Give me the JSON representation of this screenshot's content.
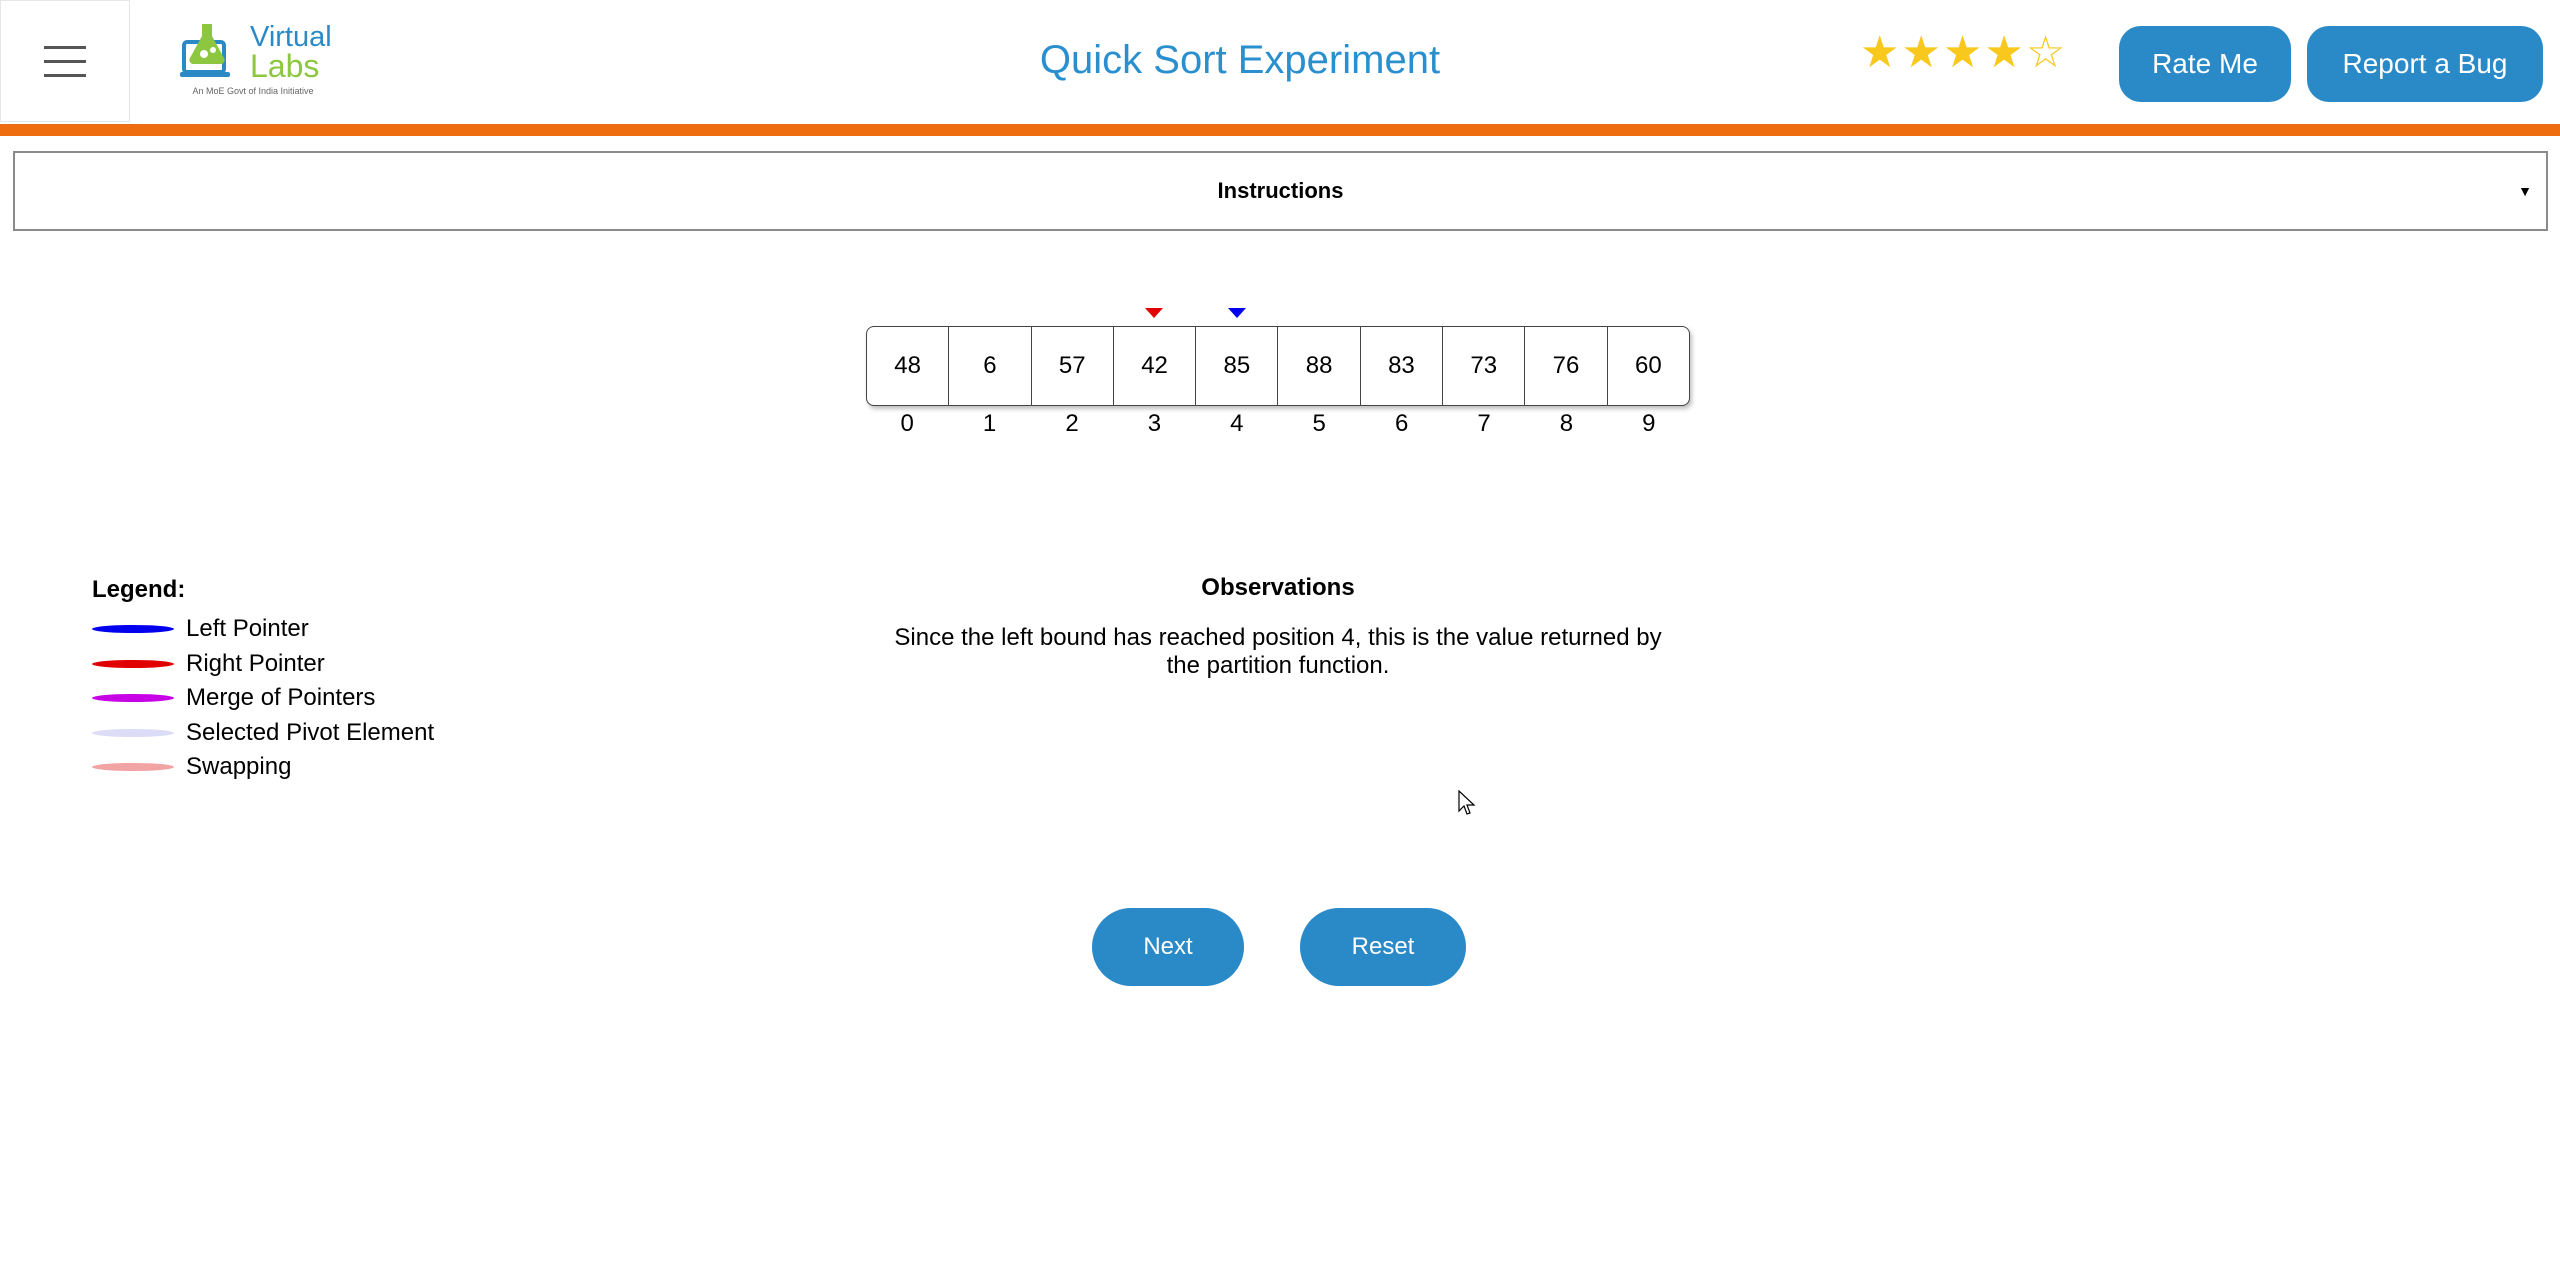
{
  "header": {
    "logo": {
      "title": "Virtual",
      "subtitle": "Labs",
      "tagline": "An MoE Govt of India Initiative"
    },
    "title": "Quick Sort Experiment",
    "rating": {
      "value": 4,
      "max": 5
    },
    "rate_label": "Rate Me",
    "bug_label": "Report a Bug"
  },
  "instructions": {
    "label": "Instructions"
  },
  "array": {
    "values": [
      "48",
      "6",
      "57",
      "42",
      "85",
      "88",
      "83",
      "73",
      "76",
      "60"
    ],
    "indices": [
      "0",
      "1",
      "2",
      "3",
      "4",
      "5",
      "6",
      "7",
      "8",
      "9"
    ],
    "right_pointer_index": 3,
    "left_pointer_index": 4
  },
  "legend": {
    "title": "Legend:",
    "items": [
      {
        "label": "Left Pointer",
        "color": "#0000ee"
      },
      {
        "label": "Right Pointer",
        "color": "#e00000"
      },
      {
        "label": "Merge of Pointers",
        "color": "#c800e6"
      },
      {
        "label": "Selected Pivot Element",
        "color": "#dcdcf7"
      },
      {
        "label": "Swapping",
        "color": "#f2a3a3"
      }
    ]
  },
  "observations": {
    "title": "Observations",
    "text": "Since the left bound has reached position 4, this is the value returned by the partition function."
  },
  "actions": {
    "next_label": "Next",
    "reset_label": "Reset"
  },
  "colors": {
    "accent": "#2a89c7",
    "title": "#2a8fcf",
    "bar": "#ee6d0e",
    "star": "#f8c81c"
  }
}
